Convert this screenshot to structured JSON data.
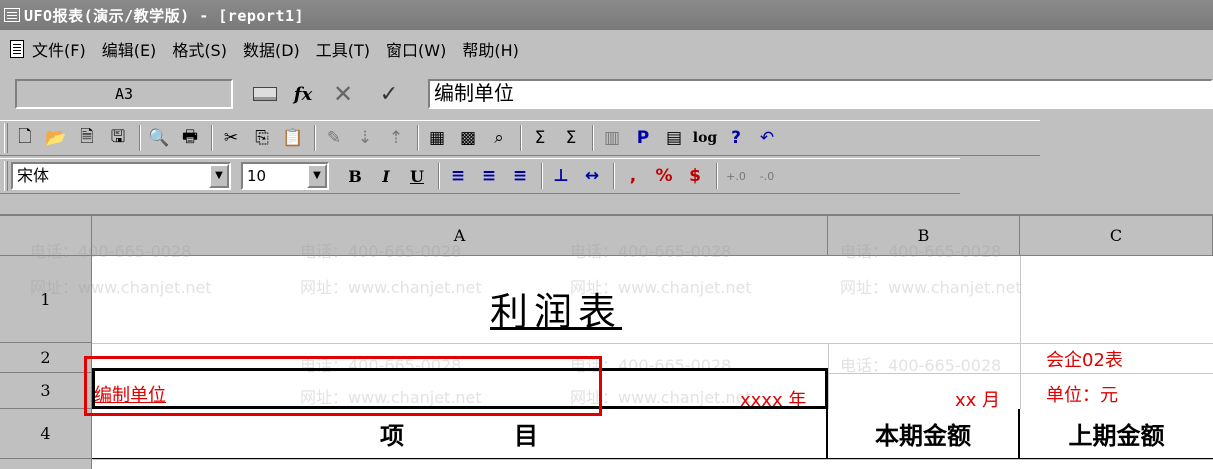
{
  "window": {
    "title": "UFO报表(演示/教学版) - [report1]"
  },
  "menu": [
    "文件(F)",
    "编辑(E)",
    "格式(S)",
    "数据(D)",
    "工具(T)",
    "窗口(W)",
    "帮助(H)"
  ],
  "formula_bar": {
    "cell_ref": "A3",
    "content": "编制单位",
    "fx_label": "fx"
  },
  "font_bar": {
    "font": "宋体",
    "size": "10"
  },
  "toolbar_glyphs": {
    "bold": "B",
    "italic": "I",
    "underline": "U",
    "comma": ",",
    "percent": "%",
    "currency": "$",
    "sum": "Σ",
    "p": "P",
    "log": "log",
    "help": "?"
  },
  "sheet": {
    "columns": [
      "A",
      "B",
      "C"
    ],
    "rows": [
      "1",
      "2",
      "3",
      "4"
    ],
    "title": "利润表",
    "code": "会企02表",
    "unit": "单位：元",
    "org": "编制单位",
    "year": "xxxx 年",
    "month": "xx 月",
    "header_item": "项目",
    "header_current": "本期金额",
    "header_previous": "上期金额"
  },
  "watermark": {
    "phone": "电话：400-665-0028",
    "site": "网址：www.chanjet.net"
  },
  "colors": {
    "accent_red": "#e00000",
    "title_bar": "#808080",
    "chrome": "#c0c0c0"
  }
}
